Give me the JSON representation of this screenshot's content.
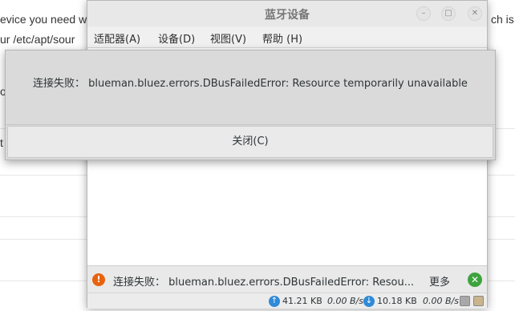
{
  "background_page": {
    "line1": "evice you need w",
    "line1_right": "ch is",
    "line2": "ur /etc/apt/sour",
    "frag_o": "o",
    "frag_t": "t"
  },
  "window": {
    "title": "蓝牙设备",
    "minimize_glyph": "–",
    "maximize_glyph": "□",
    "close_glyph": "✕"
  },
  "menubar": {
    "items": [
      {
        "label": "适配器(A)"
      },
      {
        "label": "设备(D)"
      },
      {
        "label": "视图(V)"
      },
      {
        "label": "帮助 (H)"
      }
    ]
  },
  "dialog": {
    "message": "连接失败： blueman.bluez.errors.DBusFailedError: Resource temporarily unavailable",
    "close_label": "关闭(C)"
  },
  "infobar": {
    "icon": "error-icon",
    "message": "连接失败： blueman.bluez.errors.DBusFailedError: Resou...",
    "more_label": "更多",
    "close_icon": "close-icon"
  },
  "statusbar": {
    "upload_total": "41.21 KB",
    "upload_rate": "0.00 B/s",
    "download_total": "10.18 KB",
    "download_rate": "0.00 B/s"
  },
  "colors": {
    "error_icon": "#e8620e",
    "close_icon": "#3ea33e",
    "transfer_icon": "#2f8ad8"
  }
}
